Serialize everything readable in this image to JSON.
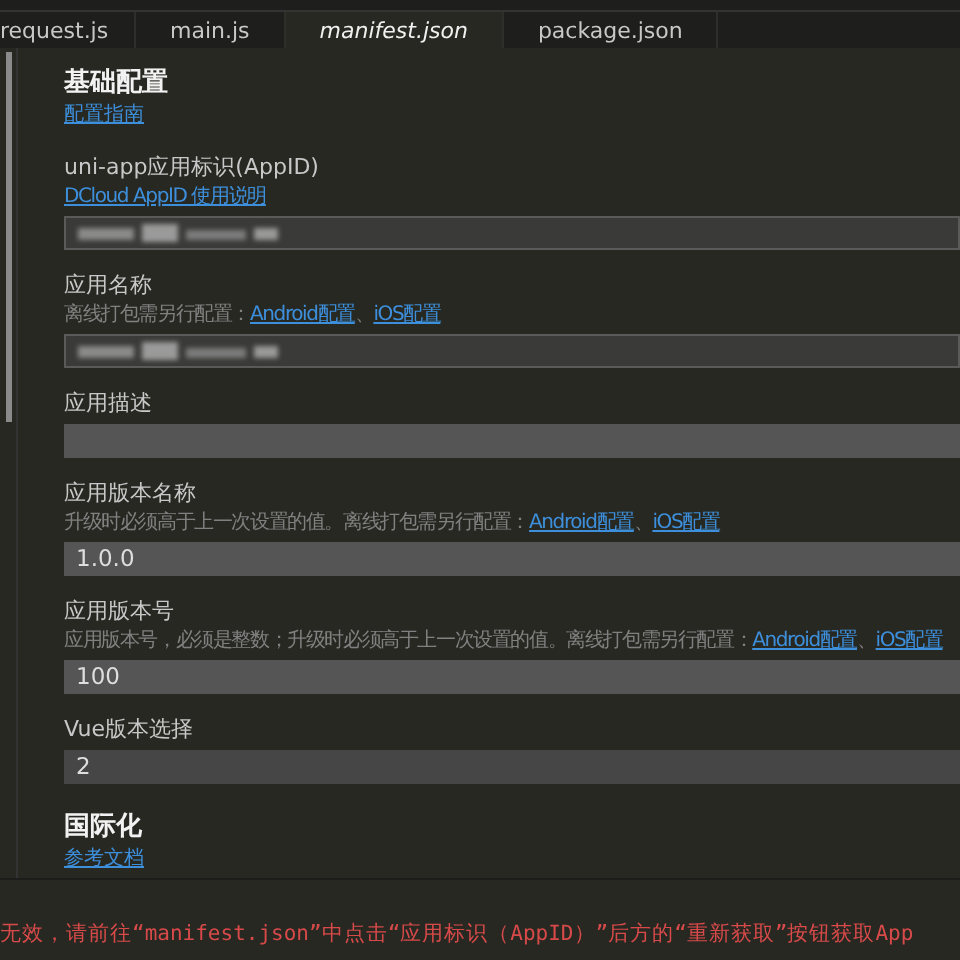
{
  "tabs": [
    {
      "label": "request.js",
      "selected": false
    },
    {
      "label": "main.js",
      "selected": false
    },
    {
      "label": "manifest.json",
      "selected": true
    },
    {
      "label": "package.json",
      "selected": false
    }
  ],
  "sections": [
    {
      "kind": "heading",
      "title": "基础配置",
      "link": "配置指南"
    },
    {
      "kind": "field",
      "label": "uni-app应用标识(AppID)",
      "hint": [
        {
          "link": "DCloud AppID 使用说明"
        }
      ],
      "redacted": true
    },
    {
      "kind": "field",
      "label": "应用名称",
      "hint": [
        {
          "text": "离线打包需另行配置："
        },
        {
          "link": "Android配置"
        },
        {
          "text": "、"
        },
        {
          "link": "iOS配置"
        }
      ],
      "redacted": true
    },
    {
      "kind": "field",
      "label": "应用描述"
    },
    {
      "kind": "field",
      "label": "应用版本名称",
      "hint": [
        {
          "text": "升级时必须高于上一次设置的值。离线打包需另行配置："
        },
        {
          "link": "Android配置"
        },
        {
          "text": "、"
        },
        {
          "link": "iOS配置"
        }
      ],
      "value": "1.0.0"
    },
    {
      "kind": "field",
      "label": "应用版本号",
      "hint": [
        {
          "text": "应用版本号，必须是整数；升级时必须高于上一次设置的值。离线打包需另行配置："
        },
        {
          "link": "Android配置"
        },
        {
          "text": "、"
        },
        {
          "link": "iOS配置"
        }
      ],
      "value": "100"
    },
    {
      "kind": "select",
      "label": "Vue版本选择",
      "value": "2"
    },
    {
      "kind": "heading",
      "title": "国际化",
      "link": "参考文档"
    }
  ],
  "console": {
    "message": "无效，请前往“manifest.json”中点击“应用标识（AppID）”后方的“重新获取”按钮获取App"
  }
}
